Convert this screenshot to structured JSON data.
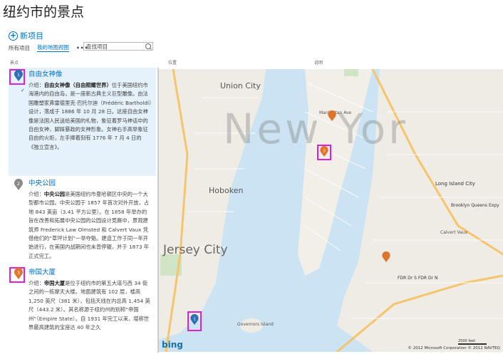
{
  "page": {
    "title": "纽约市的景点"
  },
  "toolbar": {
    "new_item": "新项目"
  },
  "views": {
    "all_items": "所有项目",
    "my_map_view": "我的地图视图",
    "more": "•••"
  },
  "search": {
    "placeholder": "查找项目"
  },
  "columns": {
    "attraction": "景点",
    "location": "位置",
    "description": "说明"
  },
  "items": [
    {
      "name": "自由女神像",
      "number": "1",
      "color": "#2d6fb5",
      "desc_prefix": "介绍：",
      "desc_bold": "自由女神像（自由照耀世界）",
      "desc_rest": "位于美国纽约市海港内的自由岛，是一座新古典主义巨型雕像。由法国雕塑家弗雷德里克·巴托尔迪（Frédéric Bartholdi）设计，落成于 1886 年 10 月 28 日。这座自由女神像是法国人民送给美国的礼物，象征着罗马神话中的自由女神，脚踩暴政的女神形象。女神右手高举象征自由的火炬，左手捧着刻有 1776 年 7 月 4 日的《独立宣言》。"
    },
    {
      "name": "中央公园",
      "number": "2",
      "color": "#8a8a8a",
      "desc_prefix": "介绍：",
      "desc_bold": "中央公园",
      "desc_rest": "是美国纽约市曼哈顿区中央的一个大型都市公园。中央公园于 1857 年首次对外开放，占地 843 英亩（3.41 平方公里）。在 1858 年举办的旨在改善和拓展中央公园的公园设计竞赛中，景观建筑师 Frederick Law Olmsted 和 Calvert Vaux 凭借他们的“草坪计划”一举夺魁。建造工作于同一年开始进行，在美国内战期间也未曾停辍，并于 1873 年正式完工。"
    },
    {
      "name": "帝国大厦",
      "number": "3",
      "color": "#e0742b",
      "desc_prefix": "介绍：",
      "desc_bold": "帝国大厦",
      "desc_rest": "是位于纽约市的第五大道与西 34 街之间的一栋摩天大楼。地面建筑有 102 层，楼高 1,250 英尺（381 米），包括天线在内总高 1,454 英尺（443.2 米）。其名称源于纽约州的别称“帝国州”（Empire State）。自 1931 年完工以来，堪称世界最高建筑的宝座达 40 年之久"
    }
  ],
  "map": {
    "labels": {
      "union_city": "Union City",
      "hoboken": "Hoboken",
      "jersey_city": "Jersey City",
      "new_york": "New Yor",
      "manhattan_ave": "Manhattan Ave",
      "long_island_city": "Long Island City",
      "brooklyn_queens": "Brooklyn Queens Expy",
      "governors_island": "Governors Island",
      "fdr_dr": "FDR Dr S FDR Dr N",
      "calvert": "Calvert Vaux"
    },
    "scale_label": "2500 feet",
    "logo": "bing",
    "copyright": "© 2012 Microsoft Corporation   © 2012 NAVTEQ",
    "pin_colors": {
      "blue": "#2d6fb5",
      "orange": "#e0742b"
    }
  }
}
